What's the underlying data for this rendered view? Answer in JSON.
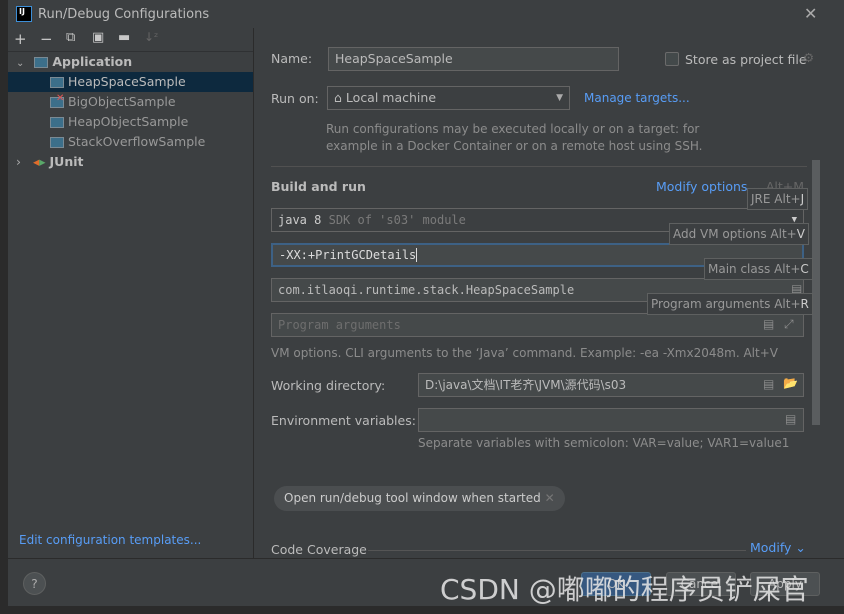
{
  "window": {
    "title": "Run/Debug Configurations",
    "logo": "IJ"
  },
  "toolbar": {
    "icons": [
      "add-icon",
      "remove-icon",
      "copy-icon",
      "save-icon",
      "new-folder-icon",
      "sort-icon"
    ]
  },
  "tree": {
    "application": "Application",
    "items": [
      "HeapSpaceSample",
      "BigObjectSample",
      "HeapObjectSample",
      "StackOverflowSample"
    ],
    "junit": "JUnit",
    "selected": "HeapSpaceSample"
  },
  "edit_templates": "Edit configuration templates...",
  "name": {
    "label": "Name:",
    "value": "HeapSpaceSample"
  },
  "store": {
    "label": "Store as project file",
    "checked": false
  },
  "run_on": {
    "label": "Run on:",
    "value": "Local machine",
    "manage": "Manage targets...",
    "hint1": "Run configurations may be executed locally or on a target: for",
    "hint2": "example in a Docker Container or on a remote host using SSH."
  },
  "build": {
    "title": "Build and run",
    "modify": "Modify options",
    "modify_shortcut": "Alt+M",
    "jre_strong": "java 8",
    "jre_hint": "SDK of 's03' module",
    "vm_options": "-XX:+PrintGCDetails",
    "main_class": "com.itlaoqi.runtime.stack.HeapSpaceSample",
    "program_args_placeholder": "Program arguments",
    "vm_hint": "VM options. CLI arguments to the ‘Java’ command. Example: -ea -Xmx2048m. Alt+V"
  },
  "tooltips": {
    "jre": "JRE Alt+",
    "jre_key": "J",
    "vm": "Add VM options Alt+",
    "vm_key": "V",
    "main": "Main class Alt+",
    "main_key": "C",
    "args": "Program arguments Alt+",
    "args_key": "R"
  },
  "workdir": {
    "label": "Working directory:",
    "value": "D:\\java\\文档\\IT老齐\\JVM\\源代码\\s03"
  },
  "env": {
    "label": "Environment variables:",
    "value": "",
    "hint": "Separate variables with semicolon: VAR=value; VAR1=value1"
  },
  "chip": {
    "label": "Open run/debug tool window when started"
  },
  "coverage": {
    "label": "Code Coverage",
    "modify": "Modify"
  },
  "buttons": {
    "help": "?",
    "ok": "OK",
    "cancel": "Cancel",
    "apply": "Apply"
  },
  "watermark": "CSDN @嘟嘟的程序员铲屎官",
  "colors": {
    "accent": "#589df6",
    "selection": "#0d293e",
    "background": "#3c3f41"
  }
}
